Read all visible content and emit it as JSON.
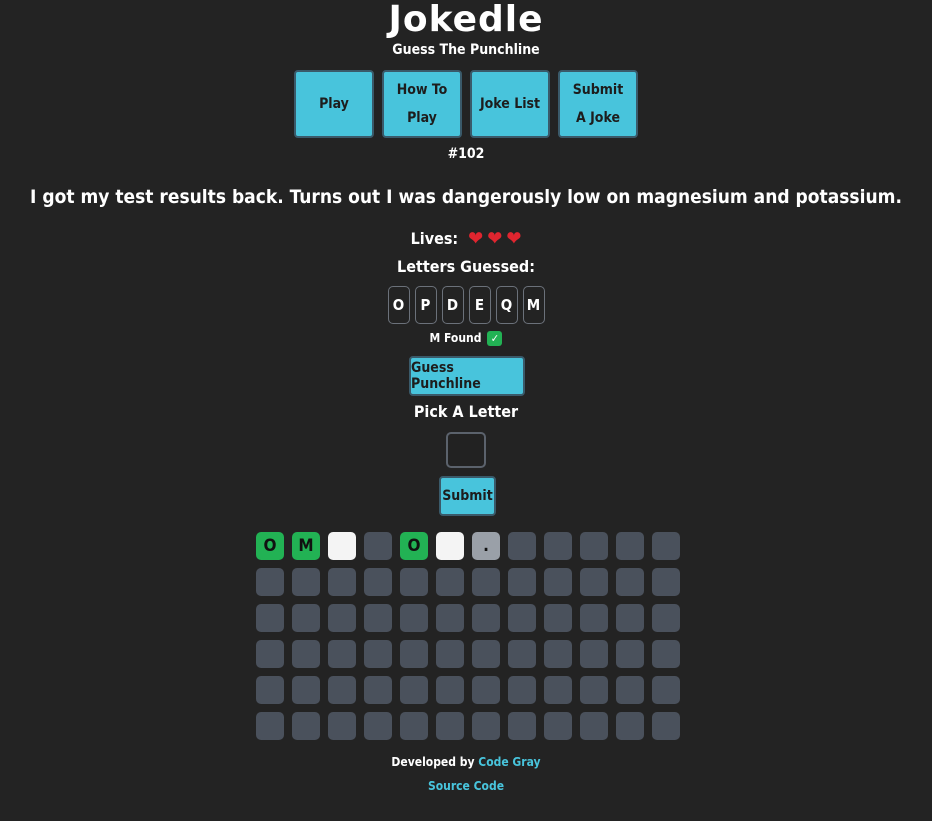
{
  "header": {
    "title": "Jokedle",
    "subtitle": "Guess The Punchline"
  },
  "nav": {
    "play": "Play",
    "how_to_play": "How To Play",
    "joke_list": "Joke List",
    "submit_joke": "Submit A Joke"
  },
  "puzzle": {
    "number": "#102",
    "setup": "I got my test results back. Turns out I was dangerously low on magnesium and potassium."
  },
  "lives": {
    "label": "Lives:",
    "count": 3,
    "icon": "heart-icon",
    "heart_glyph": "❤"
  },
  "guessed": {
    "label": "Letters Guessed:",
    "letters": [
      "O",
      "P",
      "D",
      "E",
      "Q",
      "M"
    ]
  },
  "status": {
    "message": "M Found",
    "icon": "check-icon",
    "check_glyph": "✓"
  },
  "actions": {
    "guess_punchline": "Guess Punchline",
    "pick_label": "Pick A Letter",
    "letter_value": "",
    "submit": "Submit"
  },
  "board": {
    "columns": 12,
    "rows": [
      [
        {
          "letter": "O",
          "state": "green"
        },
        {
          "letter": "M",
          "state": "green"
        },
        {
          "letter": "",
          "state": "white"
        },
        {
          "letter": "",
          "state": "empty"
        },
        {
          "letter": "O",
          "state": "green"
        },
        {
          "letter": "",
          "state": "white"
        },
        {
          "letter": ".",
          "state": "gray"
        },
        {
          "letter": "",
          "state": "empty"
        },
        {
          "letter": "",
          "state": "empty"
        },
        {
          "letter": "",
          "state": "empty"
        },
        {
          "letter": "",
          "state": "empty"
        },
        {
          "letter": "",
          "state": "empty"
        }
      ],
      [
        {
          "letter": "",
          "state": "empty"
        },
        {
          "letter": "",
          "state": "empty"
        },
        {
          "letter": "",
          "state": "empty"
        },
        {
          "letter": "",
          "state": "empty"
        },
        {
          "letter": "",
          "state": "empty"
        },
        {
          "letter": "",
          "state": "empty"
        },
        {
          "letter": "",
          "state": "empty"
        },
        {
          "letter": "",
          "state": "empty"
        },
        {
          "letter": "",
          "state": "empty"
        },
        {
          "letter": "",
          "state": "empty"
        },
        {
          "letter": "",
          "state": "empty"
        },
        {
          "letter": "",
          "state": "empty"
        }
      ],
      [
        {
          "letter": "",
          "state": "empty"
        },
        {
          "letter": "",
          "state": "empty"
        },
        {
          "letter": "",
          "state": "empty"
        },
        {
          "letter": "",
          "state": "empty"
        },
        {
          "letter": "",
          "state": "empty"
        },
        {
          "letter": "",
          "state": "empty"
        },
        {
          "letter": "",
          "state": "empty"
        },
        {
          "letter": "",
          "state": "empty"
        },
        {
          "letter": "",
          "state": "empty"
        },
        {
          "letter": "",
          "state": "empty"
        },
        {
          "letter": "",
          "state": "empty"
        },
        {
          "letter": "",
          "state": "empty"
        }
      ],
      [
        {
          "letter": "",
          "state": "empty"
        },
        {
          "letter": "",
          "state": "empty"
        },
        {
          "letter": "",
          "state": "empty"
        },
        {
          "letter": "",
          "state": "empty"
        },
        {
          "letter": "",
          "state": "empty"
        },
        {
          "letter": "",
          "state": "empty"
        },
        {
          "letter": "",
          "state": "empty"
        },
        {
          "letter": "",
          "state": "empty"
        },
        {
          "letter": "",
          "state": "empty"
        },
        {
          "letter": "",
          "state": "empty"
        },
        {
          "letter": "",
          "state": "empty"
        },
        {
          "letter": "",
          "state": "empty"
        }
      ],
      [
        {
          "letter": "",
          "state": "empty"
        },
        {
          "letter": "",
          "state": "empty"
        },
        {
          "letter": "",
          "state": "empty"
        },
        {
          "letter": "",
          "state": "empty"
        },
        {
          "letter": "",
          "state": "empty"
        },
        {
          "letter": "",
          "state": "empty"
        },
        {
          "letter": "",
          "state": "empty"
        },
        {
          "letter": "",
          "state": "empty"
        },
        {
          "letter": "",
          "state": "empty"
        },
        {
          "letter": "",
          "state": "empty"
        },
        {
          "letter": "",
          "state": "empty"
        },
        {
          "letter": "",
          "state": "empty"
        }
      ],
      [
        {
          "letter": "",
          "state": "empty"
        },
        {
          "letter": "",
          "state": "empty"
        },
        {
          "letter": "",
          "state": "empty"
        },
        {
          "letter": "",
          "state": "empty"
        },
        {
          "letter": "",
          "state": "empty"
        },
        {
          "letter": "",
          "state": "empty"
        },
        {
          "letter": "",
          "state": "empty"
        },
        {
          "letter": "",
          "state": "empty"
        },
        {
          "letter": "",
          "state": "empty"
        },
        {
          "letter": "",
          "state": "empty"
        },
        {
          "letter": "",
          "state": "empty"
        },
        {
          "letter": "",
          "state": "empty"
        }
      ]
    ]
  },
  "footer": {
    "developed_by": "Developed by",
    "developer": "Code Gray",
    "source_code": "Source Code"
  },
  "colors": {
    "background": "#232323",
    "accent": "#48c4dc",
    "correct": "#22b254",
    "present": "#f4f4f4",
    "punctuation": "#9aa0a8",
    "empty_tile": "#4a515c",
    "heart": "#e0252f"
  }
}
